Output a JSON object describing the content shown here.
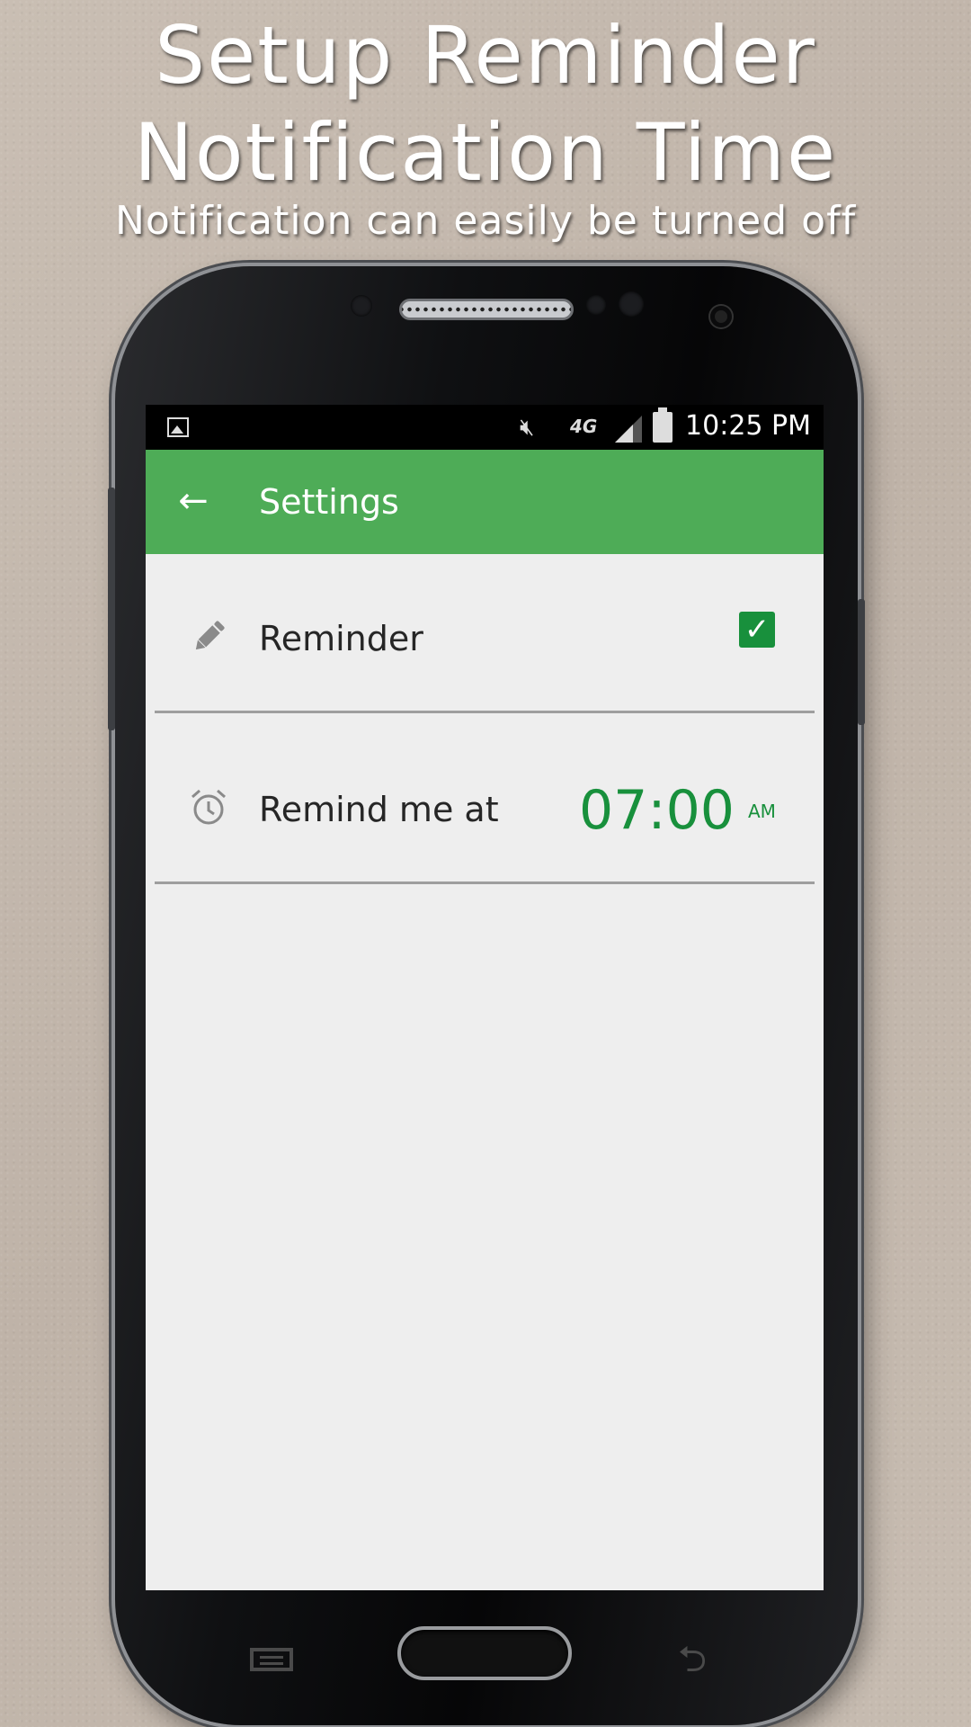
{
  "promo": {
    "title_line_1": "Setup Reminder",
    "title_line_2": "Notification Time",
    "subtitle": "Notification can easily be turned off"
  },
  "status_bar": {
    "network": "4G",
    "time": "10:25 PM"
  },
  "app_bar": {
    "title": "Settings",
    "back_icon": "arrow-left-icon"
  },
  "settings": {
    "reminder": {
      "label": "Reminder",
      "icon": "pencil-icon",
      "checked": true
    },
    "remind_time": {
      "label": "Remind me at",
      "icon": "alarm-clock-icon",
      "time": "07:00",
      "period": "AM"
    }
  },
  "colors": {
    "app_bar": "#4eac57",
    "accent": "#18903c",
    "screen_bg": "#eeeeee"
  }
}
